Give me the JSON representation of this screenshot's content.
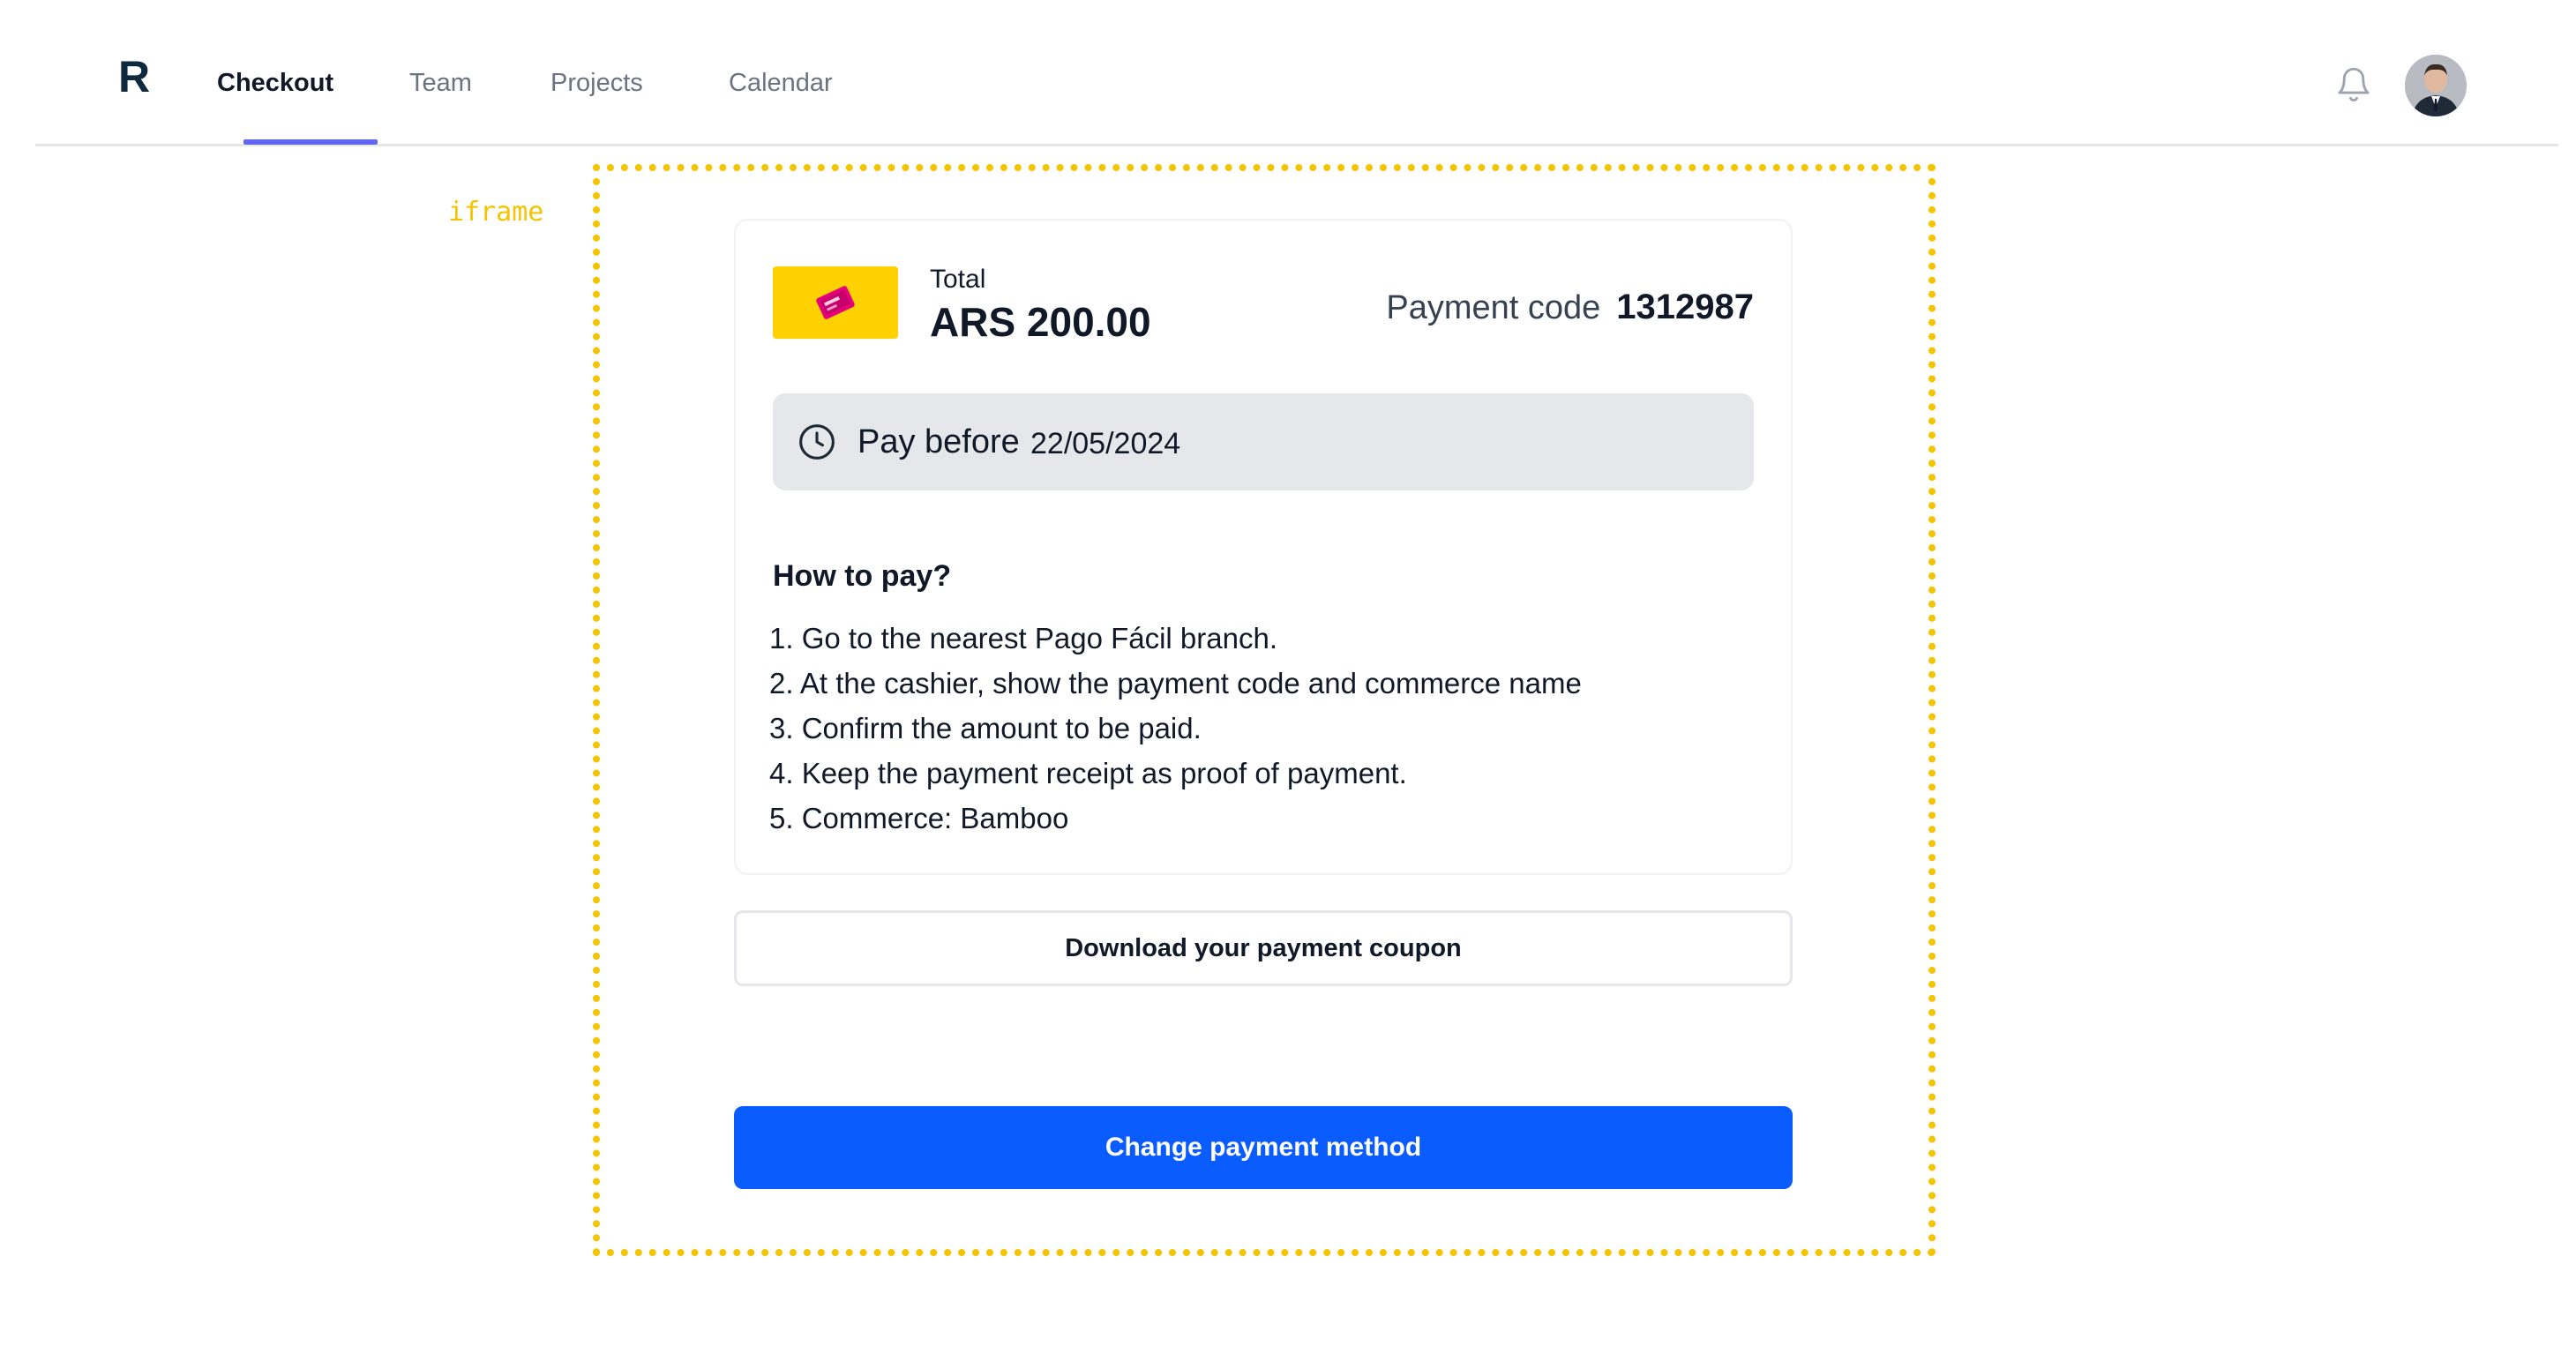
{
  "nav": {
    "logo": "R",
    "tabs": [
      {
        "label": "Checkout",
        "active": true
      },
      {
        "label": "Team",
        "active": false
      },
      {
        "label": "Projects",
        "active": false
      },
      {
        "label": "Calendar",
        "active": false
      }
    ],
    "accent_color": "#6366f1",
    "icons": [
      "bell-icon",
      "avatar"
    ]
  },
  "annotation": {
    "label": "iframe",
    "color": "#f5c400"
  },
  "payment": {
    "brand_logo": "pago-facil-logo",
    "brand_color": "#ffd100",
    "total_label": "Total",
    "total_amount": "ARS 200.00",
    "payment_code_label": "Payment code",
    "payment_code": "1312987",
    "pay_before_label": "Pay before",
    "pay_before_date": "22/05/2024",
    "how_to_title": "How to pay?",
    "steps": [
      "1. Go to the nearest Pago Fácil branch.",
      "2. At the cashier, show the payment code and commerce name",
      "3. Confirm the amount to be paid.",
      "4. Keep the payment receipt as proof of payment.",
      "5. Commerce: Bamboo"
    ]
  },
  "buttons": {
    "download": "Download your payment coupon",
    "change_method": "Change payment method",
    "primary_color": "#0a5cff"
  }
}
